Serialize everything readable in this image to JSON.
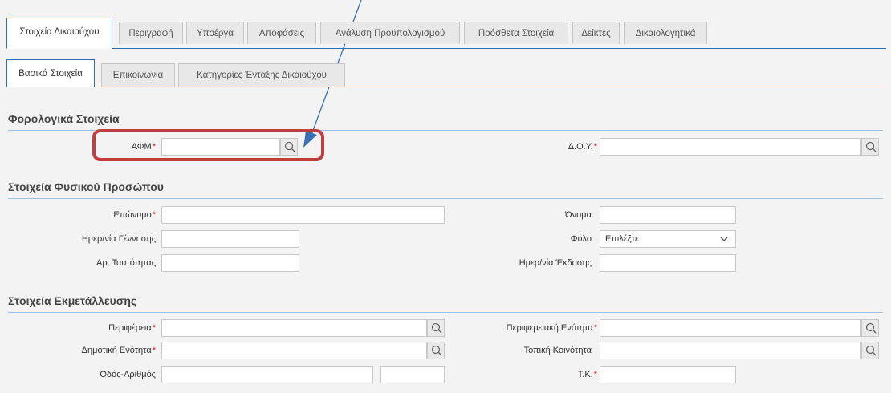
{
  "tabs_main": [
    {
      "label": "Στοιχεία Δικαιούχου",
      "active": true
    },
    {
      "label": "Περιγραφή"
    },
    {
      "label": "Υποέργα"
    },
    {
      "label": "Αποφάσεις"
    },
    {
      "label": "Ανάλυση Προϋπολογισμού"
    },
    {
      "label": "Πρόσθετα Στοιχεία"
    },
    {
      "label": "Δείκτες"
    },
    {
      "label": "Δικαιολογητικά"
    }
  ],
  "tabs_sub": [
    {
      "label": "Βασικά Στοιχεία",
      "active": true
    },
    {
      "label": "Επικοινωνία"
    },
    {
      "label": "Κατηγορίες Ένταξης Δικαιούχου"
    }
  ],
  "sections": {
    "tax": "Φορολογικά Στοιχεία",
    "person": "Στοιχεία Φυσικού Προσώπου",
    "farm": "Στοιχεία Εκμετάλλευσης"
  },
  "fields": {
    "afm": "ΑΦΜ",
    "doy": "Δ.Ο.Υ.",
    "surname": "Επώνυμο",
    "name": "Όνομα",
    "birthdate": "Ημερ/νία Γέννησης",
    "gender": "Φύλο",
    "gender_value": "Επιλέξτε",
    "id_number": "Αρ. Ταυτότητας",
    "issue_date": "Ημερ/νία Έκδοσης",
    "region": "Περιφέρεια",
    "regional_unit": "Περιφερειακή Ενότητα",
    "municipal_unit": "Δημοτική Ενότητα",
    "local_community": "Τοπική Κοινότητα",
    "street": "Οδός-Αριθμός",
    "postal_code": "Τ.Κ."
  },
  "required_mark": "*",
  "colors": {
    "accent": "#2f6fb0",
    "required": "#d0142c",
    "highlight": "#c23d3d",
    "arrow": "#3b6fb5"
  },
  "icons": {
    "search": "search-icon",
    "dropdown": "chevron-down-icon"
  }
}
